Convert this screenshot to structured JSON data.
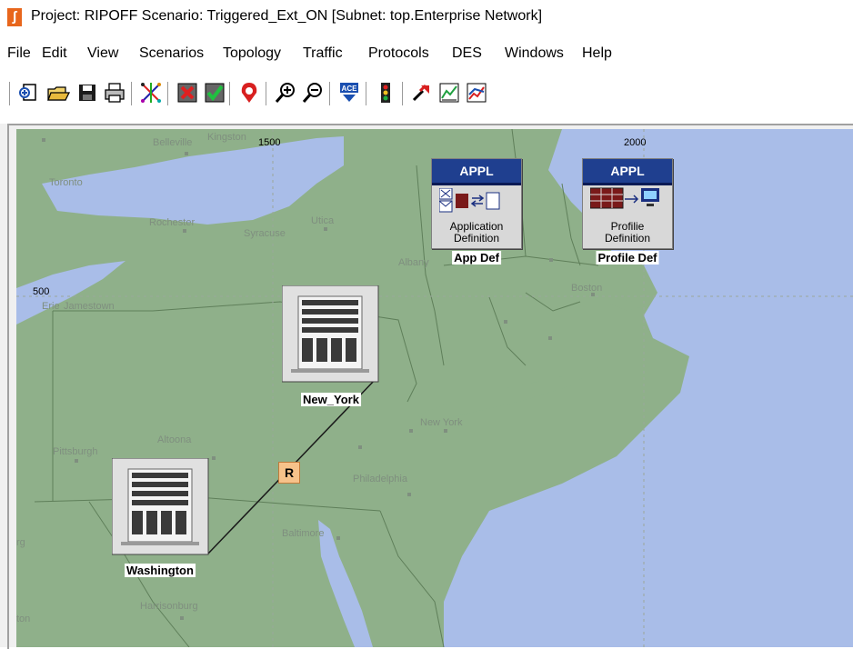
{
  "window": {
    "title": "Project: RIPOFF Scenario: Triggered_Ext_ON  [Subnet: top.Enterprise Network]",
    "app_icon": "opnet-app-icon"
  },
  "menubar": [
    "File",
    "Edit",
    "View",
    "Scenarios",
    "Topology",
    "Traffic",
    "Protocols",
    "DES",
    "Windows",
    "Help"
  ],
  "toolbar": {
    "buttons": [
      "new-project-icon",
      "open-folder-icon",
      "save-icon",
      "print-icon",
      "rapid-configuration-icon",
      "check-links-icon",
      "verify-links-icon",
      "fail-node-icon",
      "zoom-in-icon",
      "zoom-out-icon",
      "ace-import-icon",
      "traffic-light-icon",
      "configure-run-simulation-icon",
      "view-results-icon",
      "web-report-icon"
    ]
  },
  "map": {
    "colors": {
      "land": "#8fb08a",
      "water": "#a9bde8",
      "border": "#5f7f5a"
    },
    "coordinate_labels": [
      "1500",
      "2000",
      "500"
    ],
    "cities": [
      "Belleville",
      "Kingston",
      "Toronto",
      "Rochester",
      "Syracuse",
      "Utica",
      "Albany",
      "Boston",
      "Erie",
      "Jamestown",
      "New York",
      "Pittsburgh",
      "Altoona",
      "Philadelphia",
      "Baltimore",
      "Harrisonburg",
      "rg",
      "ton"
    ]
  },
  "nodes": {
    "app_def": {
      "label": "App Def",
      "header": "APPL",
      "caption_line1": "Application",
      "caption_line2": "Definition"
    },
    "profile_def": {
      "label": "Profile Def",
      "header": "APPL",
      "caption_line1": "Profilie",
      "caption_line2": "Definition"
    },
    "new_york": {
      "label": "New_York"
    },
    "washington": {
      "label": "Washington"
    }
  },
  "link": {
    "badge": "R"
  }
}
